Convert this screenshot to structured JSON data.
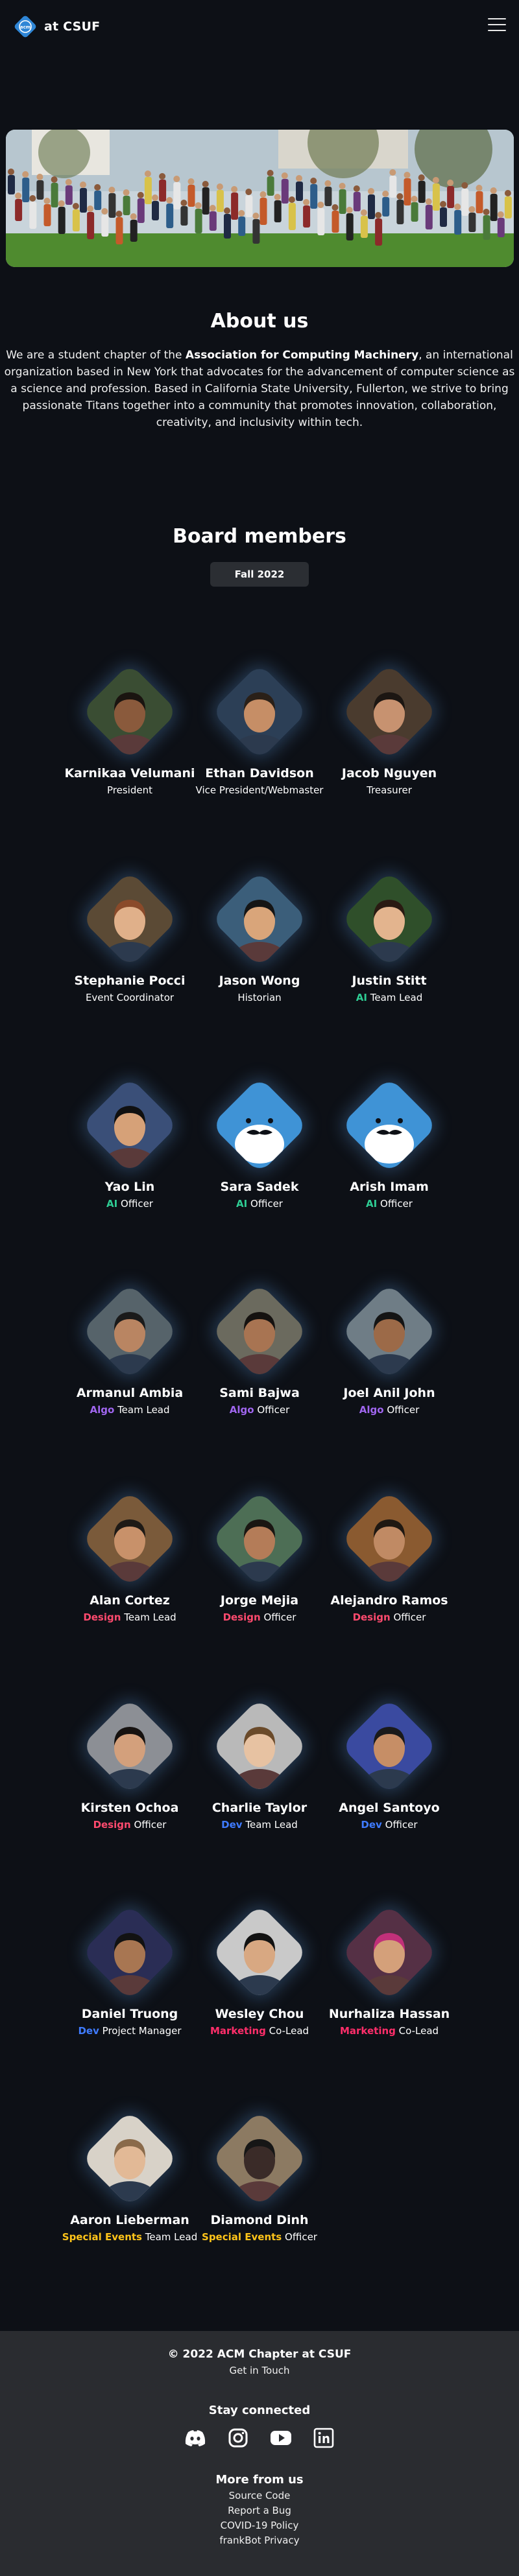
{
  "header": {
    "brand": "at CSUF",
    "logo_icon": "acm-logo-icon",
    "menu_icon": "hamburger-menu-icon"
  },
  "about": {
    "title": "About us",
    "text_before": "We are a student chapter of the ",
    "text_bold": "Association for Computing Machinery",
    "text_after": ", an international organization based in New York that advocates for the advancement of computer science as a science and profession. Based in California State University, Fullerton, we strive to bring passionate Titans together into a community that promotes innovation, collaboration, creativity, and inclusivity within tech."
  },
  "board": {
    "title": "Board members",
    "term": "Fall 2022"
  },
  "colors": {
    "ai": "#2ecc93",
    "algo": "#a066f0",
    "design": "#ff4a6e",
    "dev": "#3f7bff",
    "marketing": "#ff2e6a",
    "special": "#ffc419",
    "background": "#0d1016",
    "footer": "#2a2c30"
  },
  "members": [
    {
      "name": "Karnikaa Velumani",
      "tag": "",
      "role": "President"
    },
    {
      "name": "Ethan Davidson",
      "tag": "",
      "role": "Vice President/Webmaster"
    },
    {
      "name": "Jacob Nguyen",
      "tag": "",
      "role": "Treasurer"
    },
    {
      "name": "Stephanie Pocci",
      "tag": "",
      "role": "Event Coordinator"
    },
    {
      "name": "Jason Wong",
      "tag": "",
      "role": "Historian"
    },
    {
      "name": "Justin Stitt",
      "tag": "AI",
      "role": "Team Lead"
    },
    {
      "name": "Yao Lin",
      "tag": "AI",
      "role": "Officer"
    },
    {
      "name": "Sara Sadek",
      "tag": "AI",
      "role": "Officer"
    },
    {
      "name": "Arish Imam",
      "tag": "AI",
      "role": "Officer"
    },
    {
      "name": "Armanul Ambia",
      "tag": "Algo",
      "role": "Team Lead"
    },
    {
      "name": "Sami Bajwa",
      "tag": "Algo",
      "role": "Officer"
    },
    {
      "name": "Joel Anil John",
      "tag": "Algo",
      "role": "Officer"
    },
    {
      "name": "Alan Cortez",
      "tag": "Design",
      "role": "Team Lead"
    },
    {
      "name": "Jorge Mejia",
      "tag": "Design",
      "role": "Officer"
    },
    {
      "name": "Alejandro Ramos",
      "tag": "Design",
      "role": "Officer"
    },
    {
      "name": "Kirsten Ochoa",
      "tag": "Design",
      "role": "Officer"
    },
    {
      "name": "Charlie Taylor",
      "tag": "Dev",
      "role": "Team Lead"
    },
    {
      "name": "Angel Santoyo",
      "tag": "Dev",
      "role": "Officer"
    },
    {
      "name": "Daniel Truong",
      "tag": "Dev",
      "role": "Project Manager"
    },
    {
      "name": "Wesley Chou",
      "tag": "Marketing",
      "role": "Co-Lead"
    },
    {
      "name": "Nurhaliza Hassan",
      "tag": "Marketing",
      "role": "Co-Lead"
    },
    {
      "name": "Aaron Lieberman",
      "tag": "Special Events",
      "role": "Team Lead"
    },
    {
      "name": "Diamond Dinh",
      "tag": "Special Events",
      "role": "Officer"
    }
  ],
  "footer": {
    "copyright": "© 2022 ACM Chapter at CSUF",
    "get_in_touch": "Get in Touch",
    "stay_connected": "Stay connected",
    "socials": [
      "discord-icon",
      "instagram-icon",
      "youtube-icon",
      "linkedin-icon"
    ],
    "more_from_us": "More from us",
    "links": [
      "Source Code",
      "Report a Bug",
      "COVID-19 Policy",
      "frankBot Privacy"
    ]
  }
}
